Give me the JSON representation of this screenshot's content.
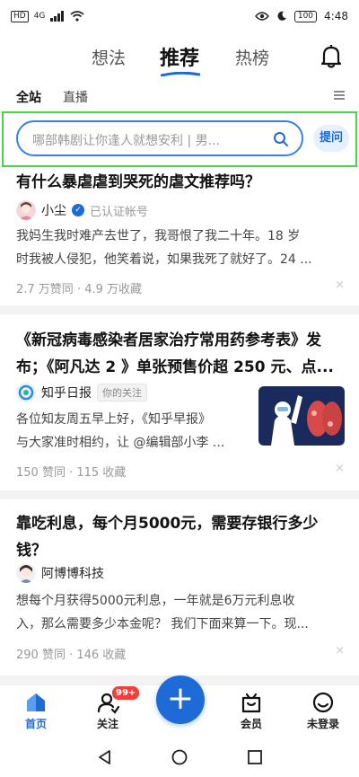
{
  "status_bar": {
    "sim": "HD",
    "signal": "4G",
    "battery": "100",
    "time": "4:48"
  },
  "top_tabs": [
    {
      "label": "想法"
    },
    {
      "label": "推荐"
    },
    {
      "label": "热榜"
    }
  ],
  "sub_tabs": [
    {
      "label": "全站"
    },
    {
      "label": "直播"
    }
  ],
  "search": {
    "placeholder": "哪部韩剧让你逢人就想安利 | 男...",
    "ask_label": "提问"
  },
  "feed": [
    {
      "title": "有什么暴虐虐到哭死的虐文推荐吗？",
      "author": "小尘",
      "verified_text": "已认证帐号",
      "excerpt_line1": "我妈生我时难产去世了，我哥恨了我二十年。18 岁",
      "excerpt_line2": "时我被人侵犯，他笑着说，如果我死了就好了。24 ...",
      "meta": "2.7 万赞同 · 4.9 万收藏",
      "dismiss": "×"
    },
    {
      "title_line1": "《新冠病毒感染者居家治疗常用药参考表》发",
      "title_line2": "布；《阿凡达 2 》单张预售价超 250 元、点...",
      "author": "知乎日报",
      "follow_badge": "你的关注",
      "excerpt_line1": "各位知友周五早上好，《知乎早报》",
      "excerpt_line2": "与大家准时相约，让 @编辑部小李 ...",
      "meta": "150 赞同 · 115 收藏",
      "dismiss": "×"
    },
    {
      "title_line1": "靠吃利息，每个月5000元，需要存银行多少",
      "title_line2": "钱？",
      "author": "阿博博科技",
      "excerpt_line1": "想每个月获得5000元利息，一年就是6万元利息收",
      "excerpt_line2": "入，那么需要多少本金呢？ 我们下面来算一下。现...",
      "meta": "290 赞同 · 146 收藏",
      "dismiss": "×"
    }
  ],
  "bottom_nav": {
    "home": "首页",
    "follow": "关注",
    "follow_badge": "99+",
    "add": "+",
    "vip": "会员",
    "profile": "未登录"
  },
  "colors": {
    "accent": "#1e6ad6",
    "highlight": "#49d346",
    "badge": "#f1403c"
  }
}
